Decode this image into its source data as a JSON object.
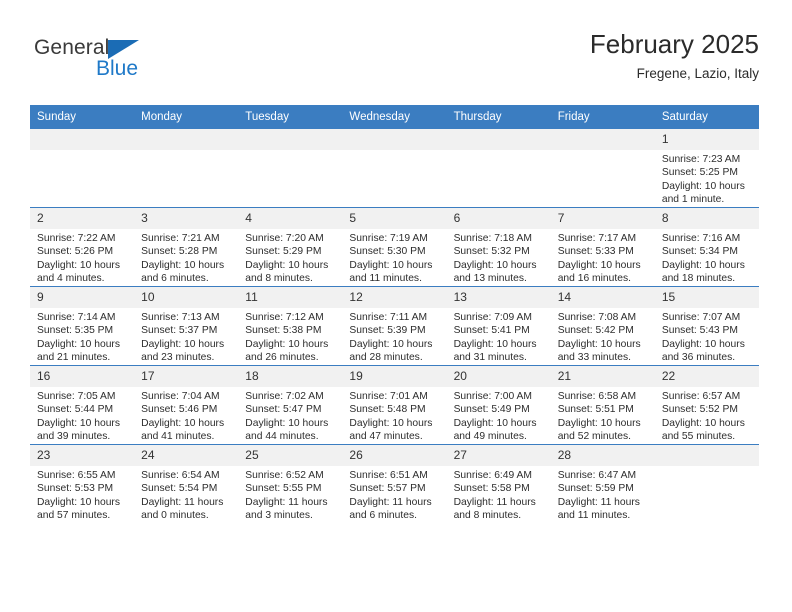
{
  "brand": {
    "name_part1": "General",
    "name_part2": "Blue",
    "triangle_color": "#1b6cb5",
    "blue_color": "#1f79c8"
  },
  "header": {
    "title": "February 2025",
    "subtitle": "Fregene, Lazio, Italy"
  },
  "theme": {
    "header_bg": "#3b7dc1",
    "daynum_bg": "#f1f1f1",
    "grid_line": "#3b7dc1"
  },
  "weekdays": [
    "Sunday",
    "Monday",
    "Tuesday",
    "Wednesday",
    "Thursday",
    "Friday",
    "Saturday"
  ],
  "weeks": [
    [
      {
        "day": "",
        "sunrise": "",
        "sunset": "",
        "daylight1": "",
        "daylight2": ""
      },
      {
        "day": "",
        "sunrise": "",
        "sunset": "",
        "daylight1": "",
        "daylight2": ""
      },
      {
        "day": "",
        "sunrise": "",
        "sunset": "",
        "daylight1": "",
        "daylight2": ""
      },
      {
        "day": "",
        "sunrise": "",
        "sunset": "",
        "daylight1": "",
        "daylight2": ""
      },
      {
        "day": "",
        "sunrise": "",
        "sunset": "",
        "daylight1": "",
        "daylight2": ""
      },
      {
        "day": "",
        "sunrise": "",
        "sunset": "",
        "daylight1": "",
        "daylight2": ""
      },
      {
        "day": "1",
        "sunrise": "Sunrise: 7:23 AM",
        "sunset": "Sunset: 5:25 PM",
        "daylight1": "Daylight: 10 hours",
        "daylight2": "and 1 minute."
      }
    ],
    [
      {
        "day": "2",
        "sunrise": "Sunrise: 7:22 AM",
        "sunset": "Sunset: 5:26 PM",
        "daylight1": "Daylight: 10 hours",
        "daylight2": "and 4 minutes."
      },
      {
        "day": "3",
        "sunrise": "Sunrise: 7:21 AM",
        "sunset": "Sunset: 5:28 PM",
        "daylight1": "Daylight: 10 hours",
        "daylight2": "and 6 minutes."
      },
      {
        "day": "4",
        "sunrise": "Sunrise: 7:20 AM",
        "sunset": "Sunset: 5:29 PM",
        "daylight1": "Daylight: 10 hours",
        "daylight2": "and 8 minutes."
      },
      {
        "day": "5",
        "sunrise": "Sunrise: 7:19 AM",
        "sunset": "Sunset: 5:30 PM",
        "daylight1": "Daylight: 10 hours",
        "daylight2": "and 11 minutes."
      },
      {
        "day": "6",
        "sunrise": "Sunrise: 7:18 AM",
        "sunset": "Sunset: 5:32 PM",
        "daylight1": "Daylight: 10 hours",
        "daylight2": "and 13 minutes."
      },
      {
        "day": "7",
        "sunrise": "Sunrise: 7:17 AM",
        "sunset": "Sunset: 5:33 PM",
        "daylight1": "Daylight: 10 hours",
        "daylight2": "and 16 minutes."
      },
      {
        "day": "8",
        "sunrise": "Sunrise: 7:16 AM",
        "sunset": "Sunset: 5:34 PM",
        "daylight1": "Daylight: 10 hours",
        "daylight2": "and 18 minutes."
      }
    ],
    [
      {
        "day": "9",
        "sunrise": "Sunrise: 7:14 AM",
        "sunset": "Sunset: 5:35 PM",
        "daylight1": "Daylight: 10 hours",
        "daylight2": "and 21 minutes."
      },
      {
        "day": "10",
        "sunrise": "Sunrise: 7:13 AM",
        "sunset": "Sunset: 5:37 PM",
        "daylight1": "Daylight: 10 hours",
        "daylight2": "and 23 minutes."
      },
      {
        "day": "11",
        "sunrise": "Sunrise: 7:12 AM",
        "sunset": "Sunset: 5:38 PM",
        "daylight1": "Daylight: 10 hours",
        "daylight2": "and 26 minutes."
      },
      {
        "day": "12",
        "sunrise": "Sunrise: 7:11 AM",
        "sunset": "Sunset: 5:39 PM",
        "daylight1": "Daylight: 10 hours",
        "daylight2": "and 28 minutes."
      },
      {
        "day": "13",
        "sunrise": "Sunrise: 7:09 AM",
        "sunset": "Sunset: 5:41 PM",
        "daylight1": "Daylight: 10 hours",
        "daylight2": "and 31 minutes."
      },
      {
        "day": "14",
        "sunrise": "Sunrise: 7:08 AM",
        "sunset": "Sunset: 5:42 PM",
        "daylight1": "Daylight: 10 hours",
        "daylight2": "and 33 minutes."
      },
      {
        "day": "15",
        "sunrise": "Sunrise: 7:07 AM",
        "sunset": "Sunset: 5:43 PM",
        "daylight1": "Daylight: 10 hours",
        "daylight2": "and 36 minutes."
      }
    ],
    [
      {
        "day": "16",
        "sunrise": "Sunrise: 7:05 AM",
        "sunset": "Sunset: 5:44 PM",
        "daylight1": "Daylight: 10 hours",
        "daylight2": "and 39 minutes."
      },
      {
        "day": "17",
        "sunrise": "Sunrise: 7:04 AM",
        "sunset": "Sunset: 5:46 PM",
        "daylight1": "Daylight: 10 hours",
        "daylight2": "and 41 minutes."
      },
      {
        "day": "18",
        "sunrise": "Sunrise: 7:02 AM",
        "sunset": "Sunset: 5:47 PM",
        "daylight1": "Daylight: 10 hours",
        "daylight2": "and 44 minutes."
      },
      {
        "day": "19",
        "sunrise": "Sunrise: 7:01 AM",
        "sunset": "Sunset: 5:48 PM",
        "daylight1": "Daylight: 10 hours",
        "daylight2": "and 47 minutes."
      },
      {
        "day": "20",
        "sunrise": "Sunrise: 7:00 AM",
        "sunset": "Sunset: 5:49 PM",
        "daylight1": "Daylight: 10 hours",
        "daylight2": "and 49 minutes."
      },
      {
        "day": "21",
        "sunrise": "Sunrise: 6:58 AM",
        "sunset": "Sunset: 5:51 PM",
        "daylight1": "Daylight: 10 hours",
        "daylight2": "and 52 minutes."
      },
      {
        "day": "22",
        "sunrise": "Sunrise: 6:57 AM",
        "sunset": "Sunset: 5:52 PM",
        "daylight1": "Daylight: 10 hours",
        "daylight2": "and 55 minutes."
      }
    ],
    [
      {
        "day": "23",
        "sunrise": "Sunrise: 6:55 AM",
        "sunset": "Sunset: 5:53 PM",
        "daylight1": "Daylight: 10 hours",
        "daylight2": "and 57 minutes."
      },
      {
        "day": "24",
        "sunrise": "Sunrise: 6:54 AM",
        "sunset": "Sunset: 5:54 PM",
        "daylight1": "Daylight: 11 hours",
        "daylight2": "and 0 minutes."
      },
      {
        "day": "25",
        "sunrise": "Sunrise: 6:52 AM",
        "sunset": "Sunset: 5:55 PM",
        "daylight1": "Daylight: 11 hours",
        "daylight2": "and 3 minutes."
      },
      {
        "day": "26",
        "sunrise": "Sunrise: 6:51 AM",
        "sunset": "Sunset: 5:57 PM",
        "daylight1": "Daylight: 11 hours",
        "daylight2": "and 6 minutes."
      },
      {
        "day": "27",
        "sunrise": "Sunrise: 6:49 AM",
        "sunset": "Sunset: 5:58 PM",
        "daylight1": "Daylight: 11 hours",
        "daylight2": "and 8 minutes."
      },
      {
        "day": "28",
        "sunrise": "Sunrise: 6:47 AM",
        "sunset": "Sunset: 5:59 PM",
        "daylight1": "Daylight: 11 hours",
        "daylight2": "and 11 minutes."
      },
      {
        "day": "",
        "sunrise": "",
        "sunset": "",
        "daylight1": "",
        "daylight2": ""
      }
    ]
  ]
}
